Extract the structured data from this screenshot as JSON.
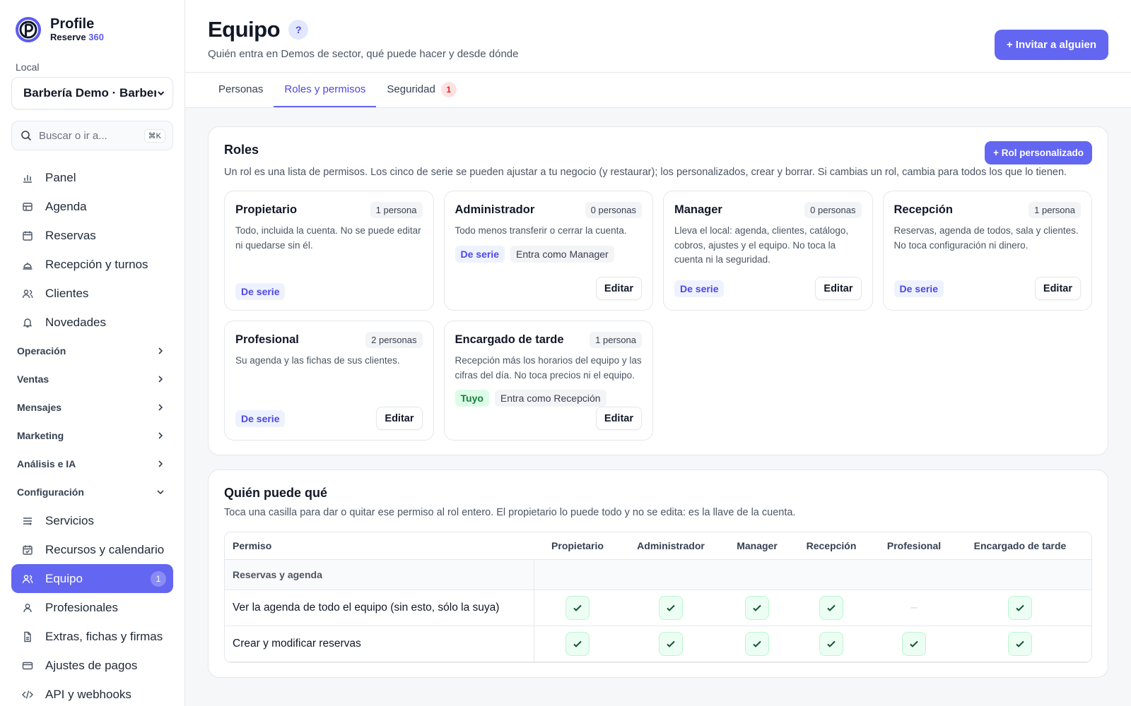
{
  "brand": {
    "name": "Profile",
    "sub_prefix": "Reserve",
    "sub_suffix": "360",
    "accent": "#5b5bf0"
  },
  "sidebar": {
    "local_label": "Local",
    "local_value": "Barbería Demo · Barberí",
    "search_placeholder": "Buscar o ir a...",
    "search_kbd": "⌘K",
    "items_top": [
      {
        "label": "Panel",
        "icon": "bar-chart-icon"
      },
      {
        "label": "Agenda",
        "icon": "table-icon"
      },
      {
        "label": "Reservas",
        "icon": "calendar-icon"
      },
      {
        "label": "Recepción y turnos",
        "icon": "bell-desk-icon"
      },
      {
        "label": "Clientes",
        "icon": "users-icon"
      },
      {
        "label": "Novedades",
        "icon": "bell-icon"
      }
    ],
    "groups": [
      "Operación",
      "Ventas",
      "Mensajes",
      "Marketing",
      "Análisis e IA",
      "Configuración"
    ],
    "items_config": [
      {
        "label": "Servicios",
        "icon": "list-icon"
      },
      {
        "label": "Recursos y calendario",
        "icon": "calendar-check-icon"
      },
      {
        "label": "Equipo",
        "icon": "users-icon",
        "badge": "1"
      },
      {
        "label": "Profesionales",
        "icon": "user-icon"
      },
      {
        "label": "Extras, fichas y firmas",
        "icon": "file-icon"
      },
      {
        "label": "Ajustes de pagos",
        "icon": "card-icon"
      },
      {
        "label": "API y webhooks",
        "icon": "code-icon"
      }
    ]
  },
  "header": {
    "title": "Equipo",
    "help": "?",
    "subtitle": "Quién entra en Demos de sector, qué puede hacer y desde dónde",
    "invite_label": "+ Invitar a alguien"
  },
  "tabs": [
    {
      "label": "Personas"
    },
    {
      "label": "Roles y permisos",
      "active": true
    },
    {
      "label": "Seguridad",
      "badge": "1"
    }
  ],
  "roles": {
    "title": "Roles",
    "button": "+ Rol personalizado",
    "description": "Un rol es una lista de permisos. Los cinco de serie se pueden ajustar a tu negocio (y restaurar); los personalizados, crear y borrar. Si cambias un rol, cambia para todos los que lo tienen.",
    "cards": [
      {
        "name": "Propietario",
        "count": "1 persona",
        "desc": "Todo, incluida la cuenta. No se puede editar ni quedarse sin él.",
        "tags": [],
        "foot_tag": "De serie",
        "edit": ""
      },
      {
        "name": "Administrador",
        "count": "0 personas",
        "desc": "Todo menos transferir o cerrar la cuenta.",
        "tags": [
          {
            "t": "De serie",
            "k": "serie"
          },
          {
            "t": "Entra como Manager",
            "k": "gray"
          }
        ],
        "foot_tag": "",
        "edit": "Editar"
      },
      {
        "name": "Manager",
        "count": "0 personas",
        "desc": "Lleva el local: agenda, clientes, catálogo, cobros, ajustes y el equipo. No toca la cuenta ni la seguridad.",
        "tags": [],
        "foot_tag": "De serie",
        "edit": "Editar"
      },
      {
        "name": "Recepción",
        "count": "1 persona",
        "desc": "Reservas, agenda de todos, sala y clientes. No toca configuración ni dinero.",
        "tags": [],
        "foot_tag": "De serie",
        "edit": "Editar"
      },
      {
        "name": "Profesional",
        "count": "2 personas",
        "desc": "Su agenda y las fichas de sus clientes.",
        "tags": [],
        "foot_tag": "De serie",
        "edit": "Editar"
      },
      {
        "name": "Encargado de tarde",
        "count": "1 persona",
        "desc": "Recepción más los horarios del equipo y las cifras del día. No toca precios ni el equipo.",
        "tags": [
          {
            "t": "Tuyo",
            "k": "tuyo"
          },
          {
            "t": "Entra como Recepción",
            "k": "gray"
          }
        ],
        "foot_tag": "",
        "edit": "Editar"
      }
    ]
  },
  "perms": {
    "title": "Quién puede qué",
    "description": "Toca una casilla para dar o quitar ese permiso al rol entero. El propietario lo puede todo y no se edita: es la llave de la cuenta.",
    "columns": [
      "Permiso",
      "Propietario",
      "Administrador",
      "Manager",
      "Recepción",
      "Profesional",
      "Encargado de tarde"
    ],
    "section": "Reservas y agenda",
    "rows": [
      {
        "label": "Ver la agenda de todo el equipo (sin esto, sólo la suya)",
        "values": [
          true,
          true,
          true,
          true,
          false,
          true
        ]
      },
      {
        "label": "Crear y modificar reservas",
        "values": [
          true,
          true,
          true,
          true,
          true,
          true
        ]
      }
    ],
    "dash": "–"
  }
}
